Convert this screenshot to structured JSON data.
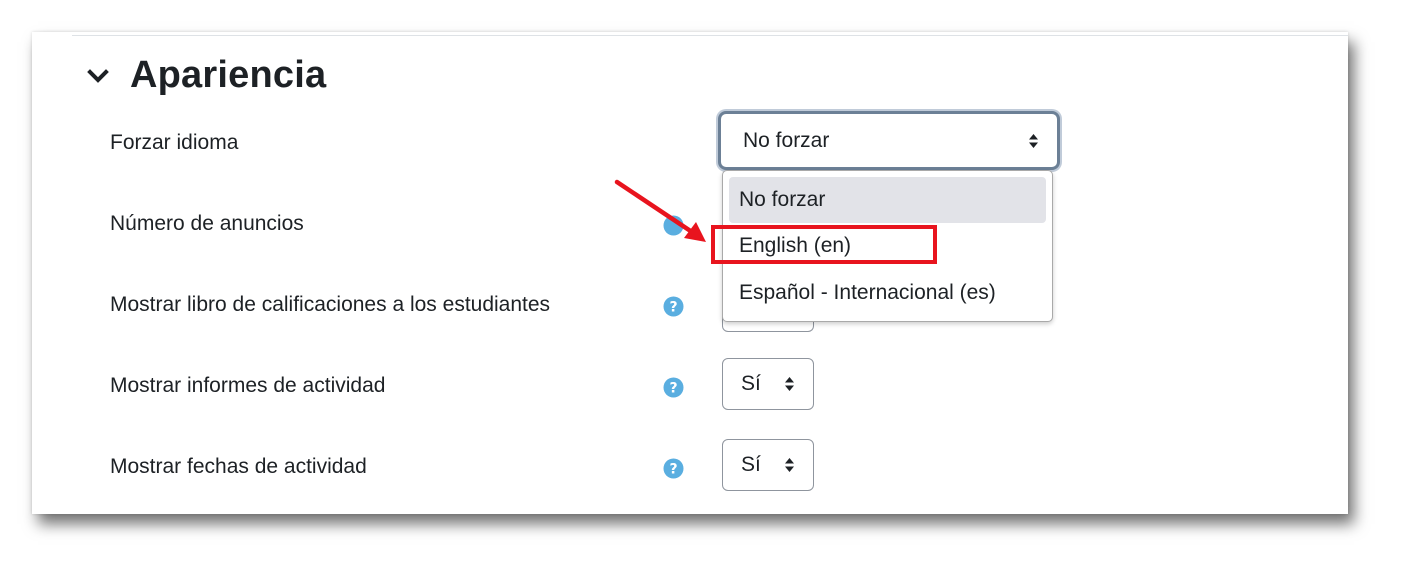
{
  "section": {
    "title": "Apariencia"
  },
  "fields": {
    "forzar_idioma": {
      "label": "Forzar idioma",
      "value": "No forzar"
    },
    "numero_anuncios": {
      "label": "Número de anuncios"
    },
    "libro_calificaciones": {
      "label": "Mostrar libro de calificaciones a los estudiantes"
    },
    "informes_actividad": {
      "label": "Mostrar informes de actividad",
      "value": "Sí"
    },
    "fechas_actividad": {
      "label": "Mostrar fechas de actividad",
      "value": "Sí"
    }
  },
  "dropdown": {
    "options": [
      "No forzar",
      "English (en)",
      "Español - Internacional (es)"
    ],
    "selected_index": 0,
    "highlighted_index": 1
  },
  "icons": {
    "help": "question-circle-icon",
    "collapse": "chevron-down-icon",
    "select_arrows": "sort-arrows-icon"
  },
  "colors": {
    "help_icon": "#5aaee0",
    "annotation_red": "#e8141e",
    "selected_option_bg": "#e2e3e8"
  }
}
